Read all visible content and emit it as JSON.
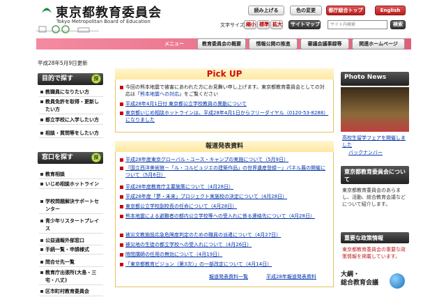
{
  "header": {
    "title": "東京都教育委員会",
    "title_en": "Tokyo Metropolitan Board of Education",
    "btn_read": "読み上げる",
    "btn_color": "色の変更",
    "btn_top": "都庁総合トップ",
    "btn_english": "English",
    "font_size_label": "文字サイズ",
    "btn_shrink": "縮小",
    "btn_standard": "標準",
    "btn_enlarge": "拡大",
    "btn_sitemap": "サイトマップ",
    "search_placeholder": "サイト内検索",
    "btn_search": "検索"
  },
  "nav": {
    "menu_label": "メニュー",
    "items": [
      "教育委員会の概要",
      "情報公開の推進",
      "審議会議事録等",
      "関連ホームページ"
    ]
  },
  "date": "平成28年5月9日更新",
  "sidebar": {
    "purpose_head": "目的で探す",
    "purpose_badge": "探",
    "purpose_items": [
      "教職員になりたい方",
      "教員免許を取得・更新したい方",
      "都立学校に入学したい方",
      "相談・質問等をしたい方"
    ],
    "counter_head": "窓口を探す",
    "counter_badge": "探",
    "counter_items": [
      "教育相談",
      "いじめ相談ホットライン",
      "学校問題解決サポートセンター",
      "青少年リスタートプレイス",
      "公益通報外部窓口",
      "手続一覧・申請様式",
      "問合せ先一覧",
      "教育庁出張所(大島・三宅・八丈)",
      "区市町村教育委員会"
    ]
  },
  "pickup": {
    "title": "Pick UP",
    "intro": "今回の熊本地震で被害にあわれた方にお見舞い申し上げます。東京都教育委員会としての対応は「",
    "intro_link": "熊本地震への対応",
    "intro_tail": "」をご覧ください",
    "items": [
      "平成28年4月1日付 東京都公立学校教員の異動について",
      "東京都いじめ相談ホットラインは、平成28年4月1日からフリーダイヤル（0120-53-8288）になりました"
    ]
  },
  "press": {
    "title": "報道発表資料",
    "items": [
      "平成28年度東京グローバル・ユース・キャンプの実施について（5月9日）",
      "『国立西洋美術館－「ル・コルビュジエの建築作品」の世界遺産登録－』パネル展の開催について（5月6日）",
      "平成28年度教育庁主要施策について（4月28日）",
      "平成28年度「夢・未来」プロジェクト実施校の決定について（4月28日）",
      "東京都公立学校副校長の任命について（4月28日）",
      "熊本地震による避難者の都内公立学校等への受入れに係る連絡先について（4月28日）",
      "被災文教施設応急危険度判定のための職員の派遣について（4月27日）",
      "被災地の生徒の都立学校への受入れについて（4月26日）",
      "時間講師の任用の無効について（4月19日）",
      "「東京都教育ビジョン（第3次）」の一部改定について（4月14日）"
    ],
    "foot_list": "報道発表資料一覧",
    "foot_2016": "平成28年報道発表資料"
  },
  "right": {
    "photo_head": "Photo News",
    "photo_caption": "高校生留学フェアを開催しました",
    "photo_back": "バックナンバー",
    "about_head": "東京都教育委員会について",
    "about_text": "東京都教育委員会のあらまし、活動、総合教育会議などについて紹介します。",
    "policy_head": "重要な政策情報",
    "policy_text": "東京都教育委員会の重要な政策情報を掲載しています。",
    "taiko_1": "大綱・",
    "taiko_2": "総合教育会議"
  }
}
